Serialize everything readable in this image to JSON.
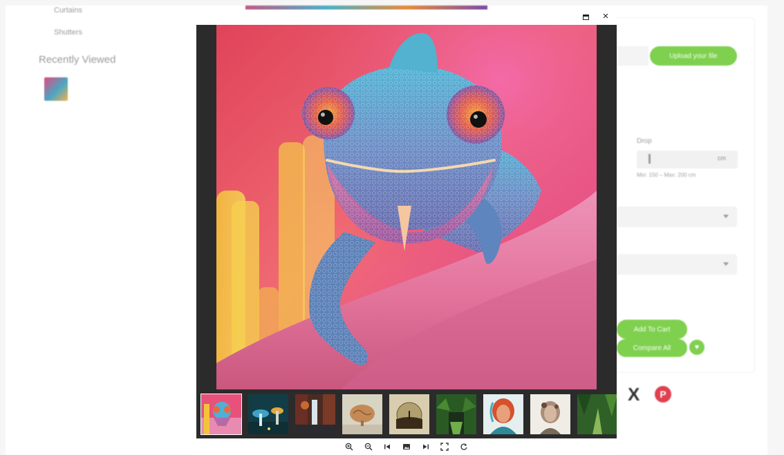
{
  "background_page": {
    "sidebar_links": [
      "Curtains",
      "Shutters"
    ],
    "recently_viewed_title": "Recently Viewed",
    "upload_button": "Upload your file",
    "drop_label": "Drop",
    "drop_unit": "cm",
    "drop_hint": "Min: 150 – Max: 200 cm",
    "add_to_cart_button": "Add To Cart",
    "compare_button": "Compare All",
    "social_icons": [
      "x-icon",
      "pinterest-icon"
    ],
    "accent_color": "#7fd04f"
  },
  "viewer": {
    "titlebar_buttons": {
      "maximize": "maximize-icon",
      "close": "×"
    },
    "main_image": {
      "subject": "chameleon-image"
    },
    "thumbnails": [
      {
        "name": "thumb-chameleon",
        "active": true
      },
      {
        "name": "thumb-mushroom-forest",
        "active": false
      },
      {
        "name": "thumb-waterfall",
        "active": false
      },
      {
        "name": "thumb-brain",
        "active": false
      },
      {
        "name": "thumb-tree-sphere",
        "active": false
      },
      {
        "name": "thumb-jungle",
        "active": false
      },
      {
        "name": "thumb-woman-portrait",
        "active": false
      },
      {
        "name": "thumb-cyborg-portrait",
        "active": false
      },
      {
        "name": "thumb-jungle-path",
        "active": false
      }
    ],
    "toolbar": [
      {
        "name": "zoom-in-icon"
      },
      {
        "name": "zoom-out-icon"
      },
      {
        "name": "previous-icon"
      },
      {
        "name": "image-icon"
      },
      {
        "name": "next-icon"
      },
      {
        "name": "fullscreen-icon"
      },
      {
        "name": "reset-icon"
      }
    ]
  }
}
